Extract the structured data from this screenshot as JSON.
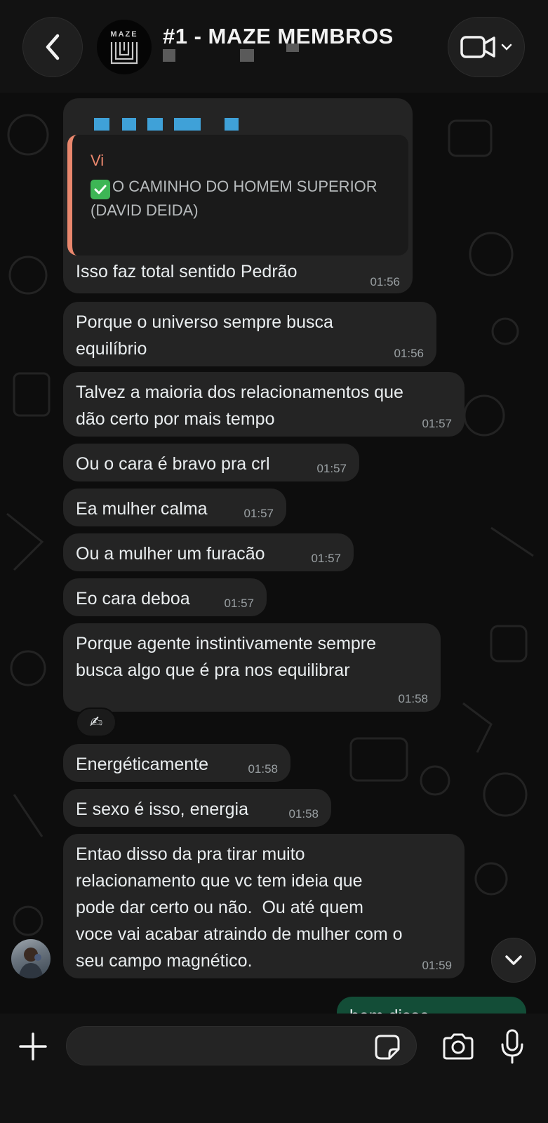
{
  "header": {
    "title": "#1 - MAZE MEMBROS",
    "group_logo_text": "MAZE"
  },
  "quoted_message": {
    "quote_author": "Vi",
    "quote_text": "O CAMINHO DO HOMEM SUPERIOR (DAVID DEIDA)",
    "reply_text": "Isso faz total sentido Pedrão",
    "time": "01:56"
  },
  "messages": [
    {
      "text": "Porque o universo sempre busca\nequilíbrio",
      "time": "01:56"
    },
    {
      "text": "Talvez a maioria dos relacionamentos que\ndão certo por mais tempo",
      "time": "01:57"
    },
    {
      "text": "Ou o cara é bravo pra crl",
      "time": "01:57"
    },
    {
      "text": "Ea mulher calma",
      "time": "01:57"
    },
    {
      "text": "Ou a mulher um furacão",
      "time": "01:57"
    },
    {
      "text": "Eo cara deboa",
      "time": "01:57"
    },
    {
      "text": "Porque agente instintivamente sempre\nbusca algo que é pra nos equilibrar",
      "time": "01:58"
    },
    {
      "text": "Energéticamente",
      "time": "01:58"
    },
    {
      "text": "E sexo é isso, energia",
      "time": "01:58"
    },
    {
      "text": "Entao disso da pra tirar muito\nrelacionamento que vc tem ideia que\npode dar certo ou não.  Ou até quem\nvoce vai acabar atraindo de mulher com o\nseu campo magnético.",
      "time": "01:59"
    }
  ],
  "reaction": {
    "emoji": "✍"
  },
  "outgoing_partial": {
    "text": "bem disse"
  },
  "input": {
    "placeholder": ""
  },
  "colors": {
    "incoming_bubble": "#242424",
    "outgoing_bubble": "#134d37",
    "quote_accent": "#e9876d",
    "sender_name": "#3fa1d8",
    "check_green": "#3db655"
  },
  "icons": [
    "back-chevron-icon",
    "video-camera-icon",
    "chevron-down-icon",
    "plus-icon",
    "sticker-icon",
    "camera-icon",
    "microphone-icon",
    "checkmark-icon"
  ]
}
